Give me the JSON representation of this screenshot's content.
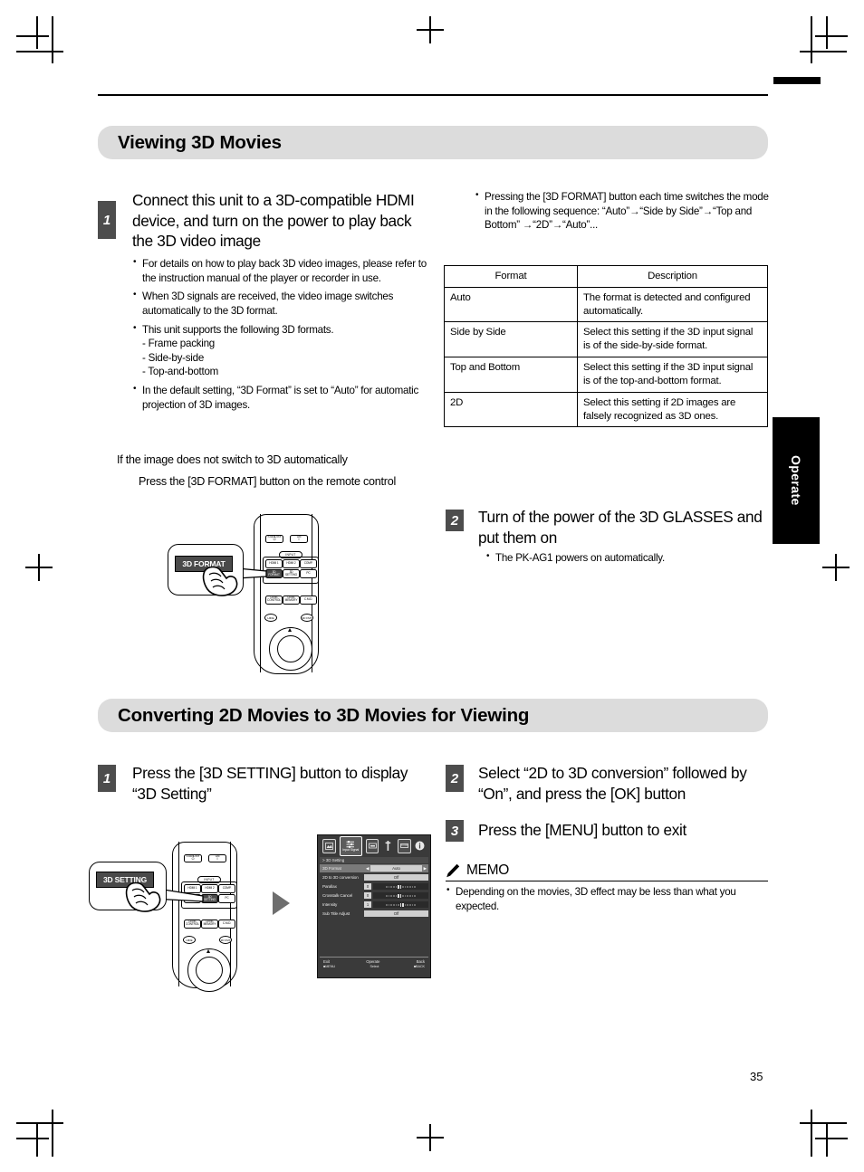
{
  "page": {
    "number": "35",
    "side_tab": "Operate"
  },
  "section1": {
    "heading": "Viewing 3D Movies",
    "step1": {
      "num": "1",
      "title": "Connect this unit to a 3D-compatible HDMI device, and turn on the power to play back the 3D video image",
      "bullets": [
        "For details on how to play back 3D video images, please refer to the instruction manual of the player or recorder in use.",
        "When 3D signals are received, the video image switches automatically to the 3D format.",
        "This unit supports the following 3D formats.",
        "In the default setting, “3D Format” is set to “Auto” for automatic projection of 3D images."
      ],
      "formats_list": [
        "- Frame packing",
        "- Side-by-side",
        "- Top-and-bottom"
      ],
      "fallback_heading": "If the image does not switch to 3D automatically",
      "fallback_body": "Press the [3D FORMAT] button on the remote control"
    },
    "right_note": "Pressing the [3D FORMAT] button each time switches the mode in the following sequence: “Auto”→“Side by Side”→“Top and Bottom” →“2D”→“Auto”...",
    "table": {
      "headers": [
        "Format",
        "Description"
      ],
      "rows": [
        [
          "Auto",
          "The format is detected and configured automatically."
        ],
        [
          "Side by Side",
          "Select this setting if the 3D input signal is of the side-by-side format."
        ],
        [
          "Top and Bottom",
          "Select this setting if the 3D input signal is of the top-and-bottom format."
        ],
        [
          "2D",
          "Select this setting if 2D images are falsely recognized as 3D ones."
        ]
      ]
    },
    "step2": {
      "num": "2",
      "title": "Turn of the power of the 3D GLASSES and put them on",
      "bullets": [
        "The PK-AG1 powers on automatically."
      ]
    },
    "remote_callout": "3D FORMAT"
  },
  "section2": {
    "heading": "Converting 2D Movies to 3D Movies for Viewing",
    "step1": {
      "num": "1",
      "title": "Press the [3D SETTING] button to display “3D Setting”"
    },
    "step2": {
      "num": "2",
      "title": "Select “2D to 3D conversion” followed by “On”, and press the [OK] button"
    },
    "step3": {
      "num": "3",
      "title": "Press the [MENU] button to exit"
    },
    "memo": {
      "title": "MEMO",
      "bullets": [
        "Depending on the movies, 3D effect may be less than what you expected."
      ]
    },
    "remote_callout": "3D SETTING"
  },
  "remote": {
    "standby_label": "STAND BY",
    "standby_glyph": "⏻",
    "on_label": "ON",
    "on_glyph": "I",
    "input_label": "INPUT",
    "buttons_row1": [
      "HDMI 1",
      "HDMI 2",
      "COMP."
    ],
    "buttons_row2": [
      "3D FORMAT",
      "3D SETTING",
      "PC"
    ],
    "buttons_row3": [
      "LENS CONTROL",
      "LENS MEMORY",
      "C.M.D."
    ],
    "small_round": [
      "HIDE",
      "3D FMT"
    ]
  },
  "osd": {
    "tabs": [
      "picture-adjust",
      "input-signal",
      "installation",
      "display-setup",
      "function",
      "information"
    ],
    "selected_tab_label": "Input Signal",
    "breadcrumb": "> 3D Setting",
    "rows": [
      {
        "label": "3D Format",
        "value": "Auto",
        "type": "select",
        "highlight": true
      },
      {
        "label": "2D to 3D conversion",
        "value": "Off",
        "type": "select",
        "highlight": false
      },
      {
        "label": "Parallax",
        "value": "0",
        "type": "slider",
        "highlight": false
      },
      {
        "label": "Crosstalk Cancel",
        "value": "0",
        "type": "slider",
        "highlight": false
      },
      {
        "label": "Intensity",
        "value": "1",
        "type": "slider",
        "highlight": false
      },
      {
        "label": "Sub Title Adjust",
        "value": "Off",
        "type": "select",
        "highlight": false
      }
    ],
    "footer": {
      "exit": "Exit",
      "exit_key": "■MENU",
      "select": "Select",
      "operate": "Operate",
      "back": "Back",
      "back_key": "■BACK"
    }
  },
  "colors": {
    "heading_bg": "#dcdcdc",
    "step_bg": "#4d4d4d",
    "tab_bg": "#000000",
    "osd_bg": "#3a3a3a"
  }
}
